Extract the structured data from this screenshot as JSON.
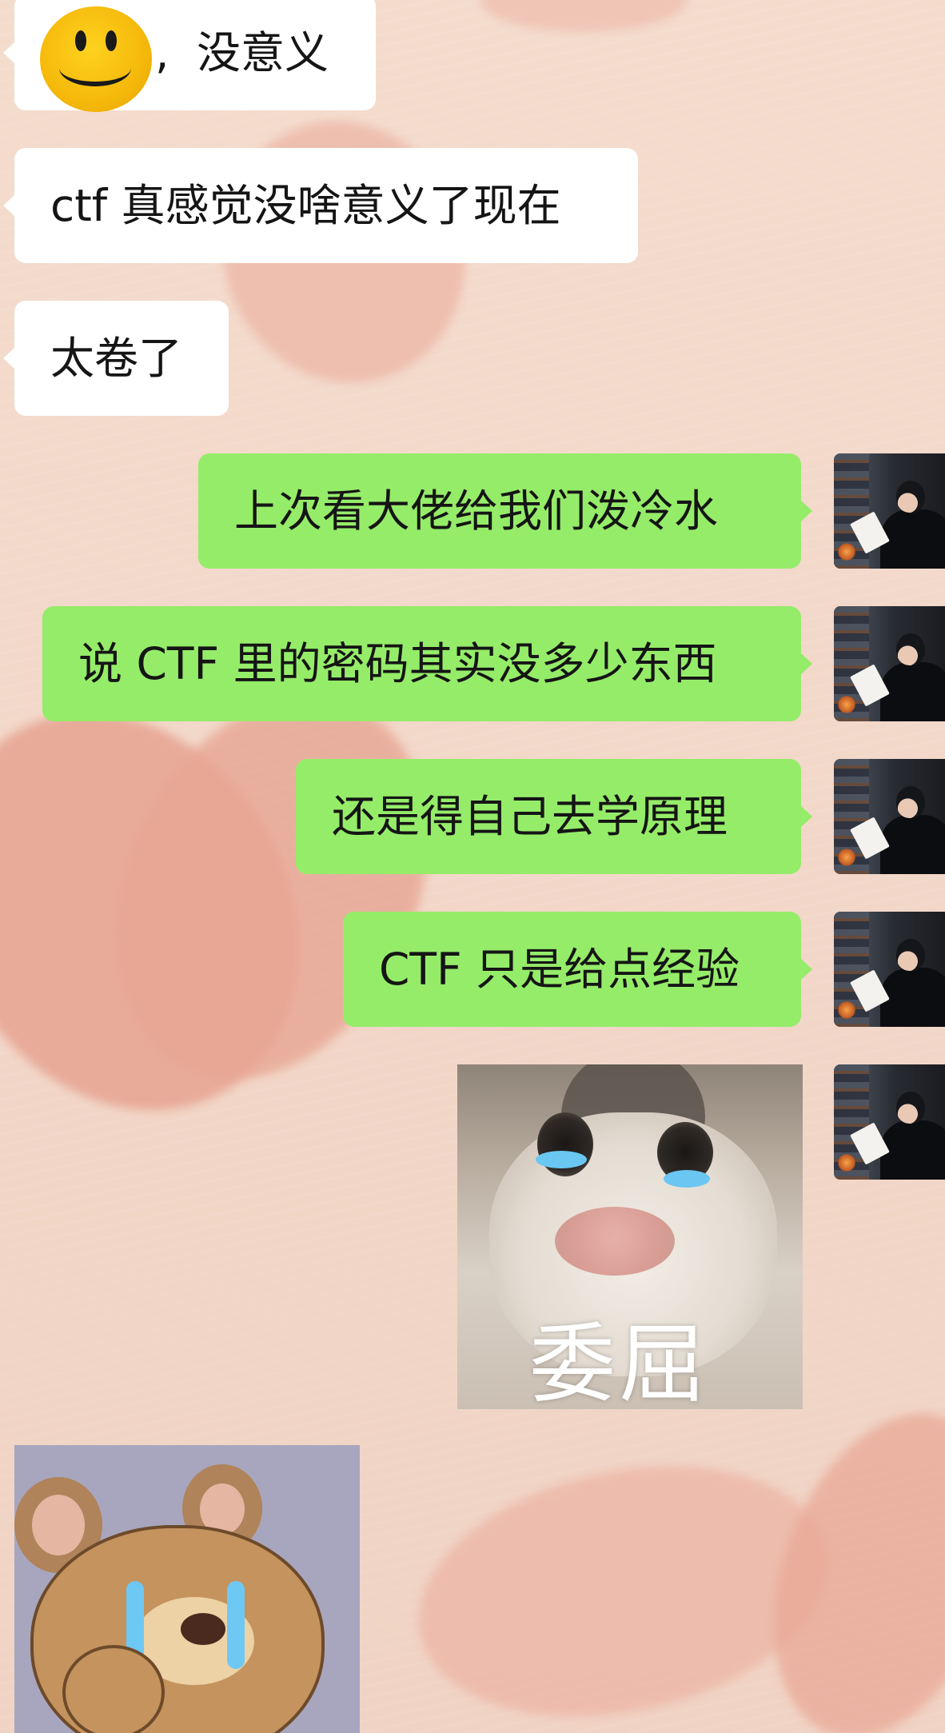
{
  "conversation": {
    "messages": [
      {
        "side": "incoming",
        "text": "没意义",
        "prefix_sticker": "smiley-face-sticker",
        "separator": ","
      },
      {
        "side": "incoming",
        "text": "ctf 真感觉没啥意义了现在"
      },
      {
        "side": "incoming",
        "text": "太卷了"
      },
      {
        "side": "outgoing",
        "text": "上次看大佬给我们泼冷水"
      },
      {
        "side": "outgoing",
        "text": "说 CTF 里的密码其实没多少东西"
      },
      {
        "side": "outgoing",
        "text": "还是得自己去学原理"
      },
      {
        "side": "outgoing",
        "text": "CTF 只是给点经验"
      },
      {
        "side": "outgoing",
        "type": "sticker",
        "sticker": "crying-cat-sticker",
        "caption": "委屈"
      },
      {
        "side": "incoming",
        "type": "sticker",
        "sticker": "crying-jerry-mouse-sticker"
      }
    ]
  },
  "colors": {
    "incoming_bubble": "#ffffff",
    "outgoing_bubble": "#95ec69",
    "text": "#151515",
    "background": "#f3ddd0",
    "heart": "#e8a493"
  }
}
